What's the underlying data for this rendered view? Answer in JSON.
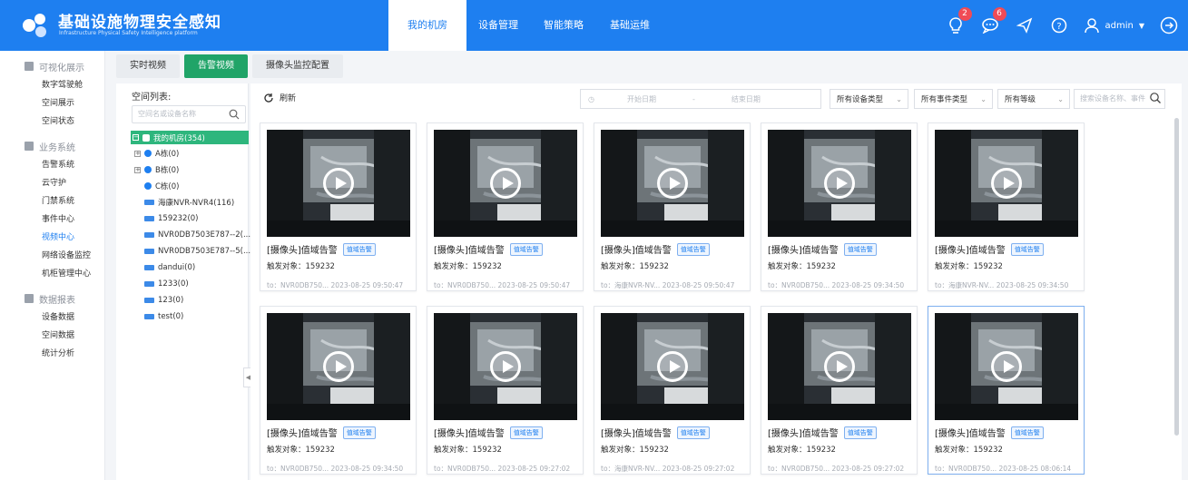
{
  "header": {
    "title": "基础设施物理安全感知",
    "subtitle": "Infrastructure Physical Safety Intelligence platform",
    "nav": [
      "我的机房",
      "设备管理",
      "智能策略",
      "基础运维"
    ],
    "active_nav": "我的机房",
    "badges": {
      "alarm": "2",
      "message": "6"
    },
    "user": "admin",
    "colors": {
      "primary": "#1e7ff0",
      "badge": "#f04b55"
    }
  },
  "sidebar": {
    "groups": [
      {
        "label": "可视化展示",
        "items": [
          "数字驾驶舱",
          "空间展示",
          "空间状态"
        ]
      },
      {
        "label": "业务系统",
        "items": [
          "告警系统",
          "云守护",
          "门禁系统",
          "事件中心",
          "视频中心",
          "网络设备监控",
          "机柜管理中心"
        ]
      },
      {
        "label": "数据报表",
        "items": [
          "设备数据",
          "空间数据",
          "统计分析"
        ]
      }
    ],
    "active_item": "视频中心"
  },
  "tabs": [
    "实时视频",
    "告警视频",
    "摄像头监控配置"
  ],
  "active_tab": "告警视频",
  "tree": {
    "title": "空间列表:",
    "search_placeholder": "空间名或设备名称",
    "root": "我的机房(354)",
    "nodes": [
      "A栋(0)",
      "B栋(0)",
      "C栋(0)",
      "海康NVR-NVR4(116)",
      "159232(0)",
      "NVR0DB7503E787--2(...",
      "NVR0DB7503E787--5(...",
      "dandui(0)",
      "1233(0)",
      "123(0)",
      "test(0)"
    ]
  },
  "toolbar": {
    "refresh": "刷新",
    "start_date": "开始日期",
    "sep": "-",
    "end_date": "结束日期",
    "device_type": "所有设备类型",
    "event_type": "所有事件类型",
    "level": "所有等级",
    "search_placeholder": "搜索设备名称、事件"
  },
  "cards": [
    {
      "title": "[摄像头]值域告警",
      "tag": "值域告警",
      "trigger": "触发对象：159232",
      "footer": "to：NVR0DB750...  2023-08-25 09:50:47"
    },
    {
      "title": "[摄像头]值域告警",
      "tag": "值域告警",
      "trigger": "触发对象：159232",
      "footer": "to：NVR0DB750...  2023-08-25 09:50:47"
    },
    {
      "title": "[摄像头]值域告警",
      "tag": "值域告警",
      "trigger": "触发对象：159232",
      "footer": "to：海康NVR-NV...  2023-08-25 09:50:47"
    },
    {
      "title": "[摄像头]值域告警",
      "tag": "值域告警",
      "trigger": "触发对象：159232",
      "footer": "to：NVR0DB750...  2023-08-25 09:34:50"
    },
    {
      "title": "[摄像头]值域告警",
      "tag": "值域告警",
      "trigger": "触发对象：159232",
      "footer": "to：海康NVR-NV...  2023-08-25 09:34:50"
    },
    {
      "title": "[摄像头]值域告警",
      "tag": "值域告警",
      "trigger": "触发对象：159232",
      "footer": "to：NVR0DB750...  2023-08-25 09:34:50"
    },
    {
      "title": "[摄像头]值域告警",
      "tag": "值域告警",
      "trigger": "触发对象：159232",
      "footer": "to：NVR0DB750...  2023-08-25 09:27:02"
    },
    {
      "title": "[摄像头]值域告警",
      "tag": "值域告警",
      "trigger": "触发对象：159232",
      "footer": "to：海康NVR-NV...  2023-08-25 09:27:02"
    },
    {
      "title": "[摄像头]值域告警",
      "tag": "值域告警",
      "trigger": "触发对象：159232",
      "footer": "to：NVR0DB750...  2023-08-25 09:27:02"
    },
    {
      "title": "[摄像头]值域告警",
      "tag": "值域告警",
      "trigger": "触发对象：159232",
      "footer": "to：NVR0DB750...  2023-08-25 08:06:14"
    }
  ]
}
